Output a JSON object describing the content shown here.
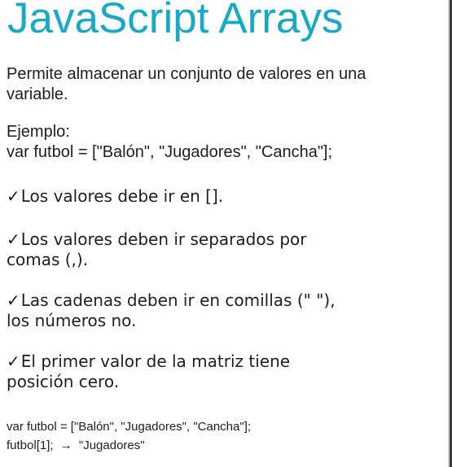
{
  "slide": {
    "title": "JavaScript Arrays",
    "intro_line1": "Permite almacenar un conjunto de valores en una",
    "intro_line2": "variable.",
    "example_label": "Ejemplo:",
    "example_code": "var futbol = [\"Balón\", \"Jugadores\", \"Cancha\"];",
    "bullets": [
      {
        "check": "✓",
        "line1": "Los valores debe ir en [].",
        "line2": ""
      },
      {
        "check": "✓",
        "line1": "Los valores deben ir separados por",
        "line2": "comas (,)."
      },
      {
        "check": "✓",
        "line1": "Las cadenas deben ir en comillas (\" \"),",
        "line2": "los números no."
      },
      {
        "check": "✓",
        "line1": "El primer valor de la matriz tiene",
        "line2": "posición cero."
      }
    ],
    "code_line1": "var futbol = [\"Balón\", \"Jugadores\", \"Cancha\"];",
    "code_line2_prefix": "futbol[1];",
    "code_line2_arrow": "→",
    "code_line2_result": "\"Jugadores\""
  },
  "colors": {
    "title": "#1aa9c4",
    "text": "#1e1e1e",
    "background": "#ffffff"
  },
  "icons": {
    "check": "check-icon",
    "arrow": "arrow-right-icon"
  }
}
